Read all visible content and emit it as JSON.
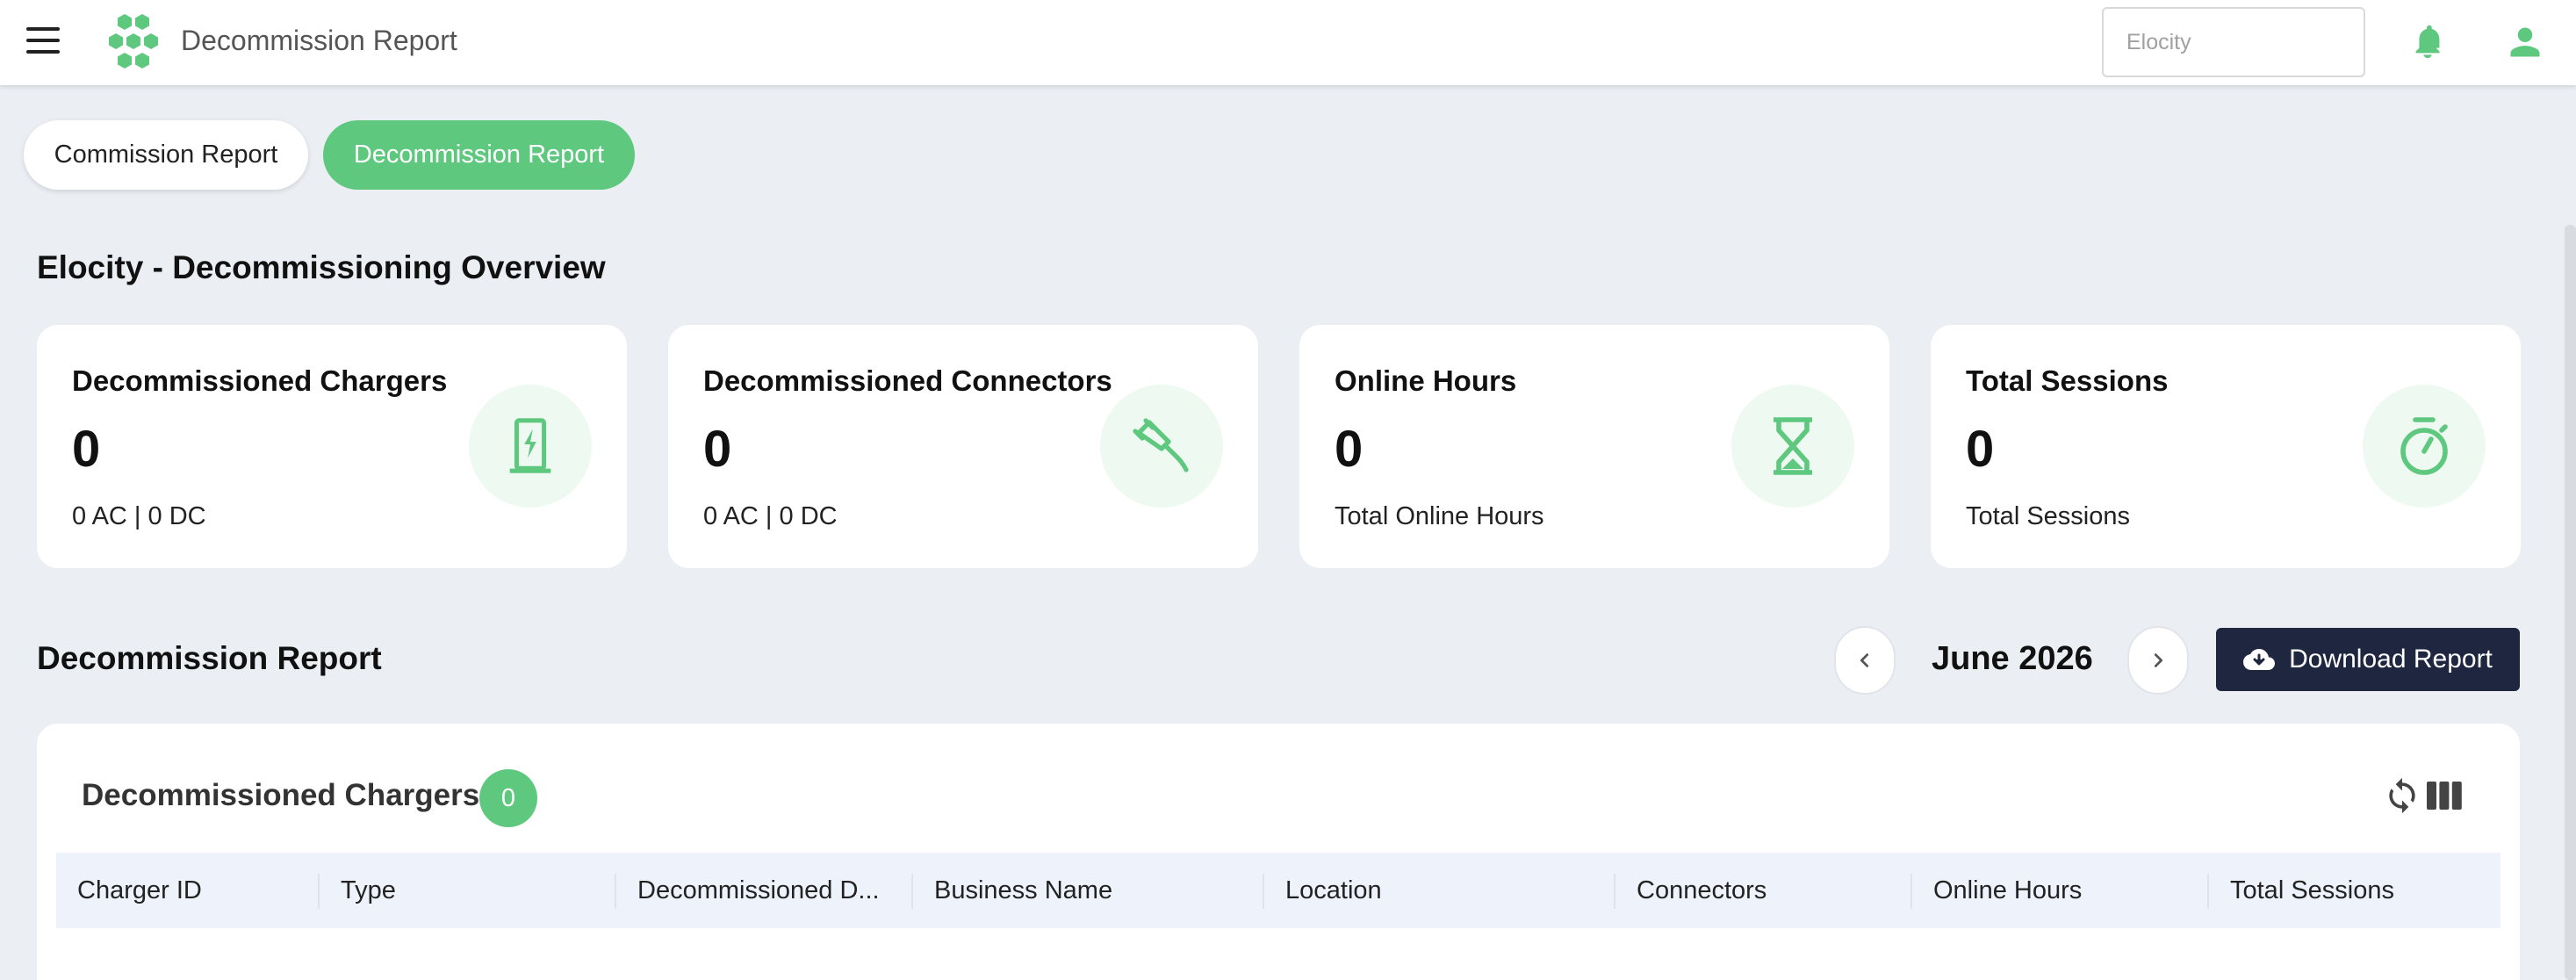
{
  "app": {
    "title": "Decommission Report"
  },
  "search": {
    "placeholder": "Elocity"
  },
  "tabs": [
    {
      "label": "Commission Report",
      "active": false
    },
    {
      "label": "Decommission Report",
      "active": true
    }
  ],
  "overview": {
    "title": "Elocity - Decommissioning Overview"
  },
  "cards": [
    {
      "title": "Decommissioned Chargers",
      "value": "0",
      "sub": "0 AC | 0 DC",
      "icon": "ev-charger-icon"
    },
    {
      "title": "Decommissioned Connectors",
      "value": "0",
      "sub": "0 AC | 0 DC",
      "icon": "ev-plug-icon"
    },
    {
      "title": "Online Hours",
      "value": "0",
      "sub": "Total Online Hours",
      "icon": "hourglass-icon"
    },
    {
      "title": "Total Sessions",
      "value": "0",
      "sub": "Total Sessions",
      "icon": "stopwatch-icon"
    }
  ],
  "report": {
    "title": "Decommission Report",
    "month": "June 2026",
    "download_label": "Download Report"
  },
  "table": {
    "title": "Decommissioned Chargers",
    "count": "0",
    "columns": [
      "Charger ID",
      "Type",
      "Decommissioned D...",
      "Business Name",
      "Location",
      "Connectors",
      "Online Hours",
      "Total Sessions"
    ]
  },
  "colors": {
    "accent": "#5ec87f",
    "accent_light": "#eef9f1",
    "dark_button": "#1f2640",
    "background": "#ebeef3"
  }
}
